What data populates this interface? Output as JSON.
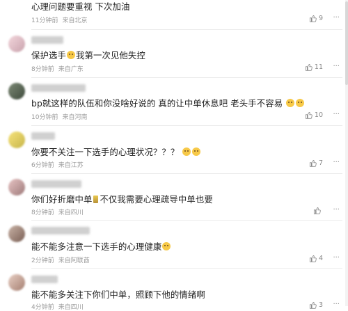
{
  "comments": [
    {
      "text": "心理问题要重视 下次加油",
      "time": "11分钟前",
      "location": "来自北京",
      "likes": "9"
    },
    {
      "text_before": "保护选手",
      "text_after": "我第一次见他失控",
      "time": "8分钟前",
      "location": "来自广东",
      "likes": "11"
    },
    {
      "text": "bp就这样的队伍和你没啥好说的 真的让中单休息吧 老头手不容易",
      "time": "10分钟前",
      "location": "来自河南",
      "likes": "10"
    },
    {
      "text": "你要不关注一下选手的心理状况？？？",
      "time": "6分钟前",
      "location": "来自江苏",
      "likes": "7"
    },
    {
      "text_before": "你们好折磨中单",
      "text_after": "不仅我需要心理疏导中单也要",
      "time": "8分钟前",
      "location": "来自四川",
      "likes": ""
    },
    {
      "text": "能不能多注意一下选手的心理健康",
      "time": "2分钟前",
      "location": "来自阿联酋",
      "likes": "4"
    },
    {
      "text": "能不能多关注下你们中单，照顾下他的情绪啊",
      "time": "4分钟前",
      "location": "来自四川",
      "likes": "3"
    }
  ],
  "more_icon": "ellipsis-icon",
  "like_icon": "thumbs-up-icon",
  "colors": {
    "meta": "#9a9a9a",
    "text": "#222222",
    "divider": "#ececec"
  }
}
